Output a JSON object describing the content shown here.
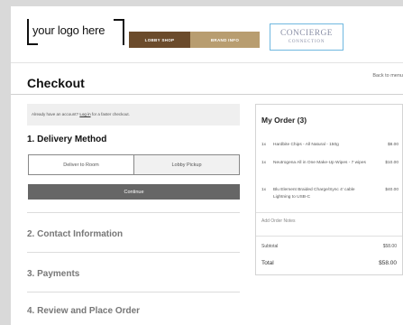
{
  "header": {
    "logo_text": "your logo here",
    "nav": [
      {
        "label": "LOBBY SHOP"
      },
      {
        "label": "BRAND INFO"
      }
    ],
    "concierge": {
      "line1": "CONCIERGE",
      "line2": "CONNECTION"
    },
    "colors": {
      "lobby": "#6b4b2b",
      "brand": "#b89d70",
      "concierge_border": "#6fb8e0"
    }
  },
  "page": {
    "title": "Checkout",
    "back_link": "Back to menu"
  },
  "signin": {
    "prefix": "Already have an account?",
    "link": "Log in",
    "suffix": "for a faster checkout."
  },
  "delivery": {
    "heading": "1. Delivery Method",
    "options": [
      {
        "label": "Deliver to Room"
      },
      {
        "label": "Lobby Pickup"
      }
    ],
    "continue_label": "Continue"
  },
  "steps": [
    {
      "label": "2. Contact Information"
    },
    {
      "label": "3. Payments"
    },
    {
      "label": "4. Review and Place Order"
    }
  ],
  "order": {
    "title": "My Order (3)",
    "items": [
      {
        "qty": "1x",
        "name": "Hardbite Chips - All Natural - 150g",
        "price": "$8.00"
      },
      {
        "qty": "1x",
        "name": "Neutrogena All in One Make-Up Wipes - 7 wipes",
        "price": "$10.00"
      },
      {
        "qty": "1x",
        "name": "Blu Element Braided Charge/Sync 4' cable Lightning to USB-C",
        "price": "$40.00"
      }
    ],
    "notes_label": "Add Order Notes",
    "subtotal_label": "Subtotal",
    "subtotal_value": "$58.00",
    "total_label": "Total",
    "total_value": "$58.00"
  }
}
